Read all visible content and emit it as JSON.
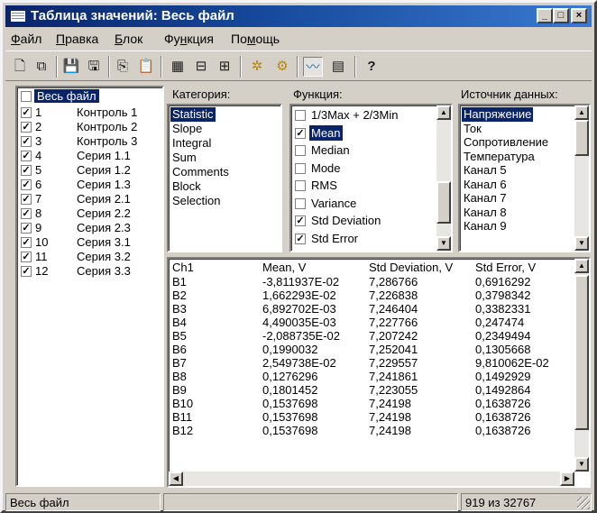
{
  "window": {
    "title": "Таблица значений: Весь файл",
    "controls": [
      "_",
      "□",
      "×"
    ]
  },
  "menu": [
    {
      "pre": "",
      "u": "Ф",
      "post": "айл"
    },
    {
      "pre": "",
      "u": "П",
      "post": "равка"
    },
    {
      "pre": "",
      "u": "Б",
      "post": "лок"
    },
    {
      "pre": "Фу",
      "u": "н",
      "post": "кция"
    },
    {
      "pre": "По",
      "u": "м",
      "post": "ощь"
    }
  ],
  "toolbar": {
    "icons": [
      "new-icon",
      "copy-doc-icon",
      "save-icon",
      "save-all-icon",
      "copy-icon",
      "paste-icon",
      "channel-vertical-icon",
      "channel-split-icon",
      "tree-icon",
      "gear-icon",
      "multi-gear-icon",
      "wave-icon",
      "histogram-icon",
      "help-icon"
    ],
    "glyphs": [
      "🗋",
      "⧉",
      "💾",
      "🖫",
      "⎘",
      "📋",
      "▦",
      "⊟",
      "⊞",
      "✲",
      "⚙",
      "〰",
      "▤",
      "?"
    ]
  },
  "tree": {
    "root": "Весь файл",
    "items": [
      {
        "num": "1",
        "name": "Контроль 1",
        "checked": true
      },
      {
        "num": "2",
        "name": "Контроль 2",
        "checked": true
      },
      {
        "num": "3",
        "name": "Контроль 3",
        "checked": true
      },
      {
        "num": "4",
        "name": "Серия 1.1",
        "checked": true
      },
      {
        "num": "5",
        "name": "Серия 1.2",
        "checked": true
      },
      {
        "num": "6",
        "name": "Серия 1.3",
        "checked": true
      },
      {
        "num": "7",
        "name": "Серия 2.1",
        "checked": true
      },
      {
        "num": "8",
        "name": "Серия 2.2",
        "checked": true
      },
      {
        "num": "9",
        "name": "Серия 2.3",
        "checked": true
      },
      {
        "num": "10",
        "name": "Серия 3.1",
        "checked": true
      },
      {
        "num": "11",
        "name": "Серия 3.2",
        "checked": true
      },
      {
        "num": "12",
        "name": "Серия 3.3",
        "checked": true
      }
    ]
  },
  "category": {
    "label": "Категория:",
    "items": [
      "Statistic",
      "Slope",
      "Integral",
      "Sum",
      "Comments",
      "Block",
      "Selection"
    ],
    "selected": 0
  },
  "function": {
    "label": "Функция:",
    "items": [
      {
        "label": "1/3Max + 2/3Min",
        "checked": false
      },
      {
        "label": "Mean",
        "checked": true
      },
      {
        "label": "Median",
        "checked": false
      },
      {
        "label": "Mode",
        "checked": false
      },
      {
        "label": "RMS",
        "checked": false
      },
      {
        "label": "Variance",
        "checked": false
      },
      {
        "label": "Std Deviation",
        "checked": true
      },
      {
        "label": "Std Error",
        "checked": true
      }
    ],
    "selected": 1
  },
  "source": {
    "label": "Источник данных:",
    "items": [
      "Напряжение",
      "Ток",
      "Сопротивление",
      "Температура",
      "Канал 5",
      "Канал 6",
      "Канал 7",
      "Канал 8",
      "Канал 9"
    ],
    "selected": 0
  },
  "table": {
    "headers": [
      "Ch1",
      "Mean, V",
      "Std Deviation, V",
      "Std Error, V"
    ],
    "rows": [
      [
        "B1",
        "-3,811937E-02",
        "7,286766",
        "0,6916292"
      ],
      [
        "B2",
        "1,662293E-02",
        "7,226838",
        "0,3798342"
      ],
      [
        "B3",
        "6,892702E-03",
        "7,246404",
        "0,3382331"
      ],
      [
        "B4",
        "4,490035E-03",
        "7,227766",
        "0,247474"
      ],
      [
        "B5",
        "-2,088735E-02",
        "7,207242",
        "0,2349494"
      ],
      [
        "B6",
        "0,1990032",
        "7,252041",
        "0,1305668"
      ],
      [
        "B7",
        "2,549738E-02",
        "7,229557",
        "9,810062E-02"
      ],
      [
        "B8",
        "0,1276296",
        "7,241861",
        "0,1492929"
      ],
      [
        "B9",
        "0,1801452",
        "7,223055",
        "0,1492864"
      ],
      [
        "B10",
        "0,1537698",
        "7,24198",
        "0,1638726"
      ],
      [
        "B11",
        "0,1537698",
        "7,24198",
        "0,1638726"
      ],
      [
        "B12",
        "0,1537698",
        "7,24198",
        "0,1638726"
      ]
    ]
  },
  "status": {
    "left": "Весь файл",
    "middle": "",
    "right": "919 из 32767"
  },
  "colors": {
    "title_start": "#0a246a",
    "title_end": "#3a7ad0",
    "selection": "#0a246a",
    "face": "#d4d0c8"
  }
}
